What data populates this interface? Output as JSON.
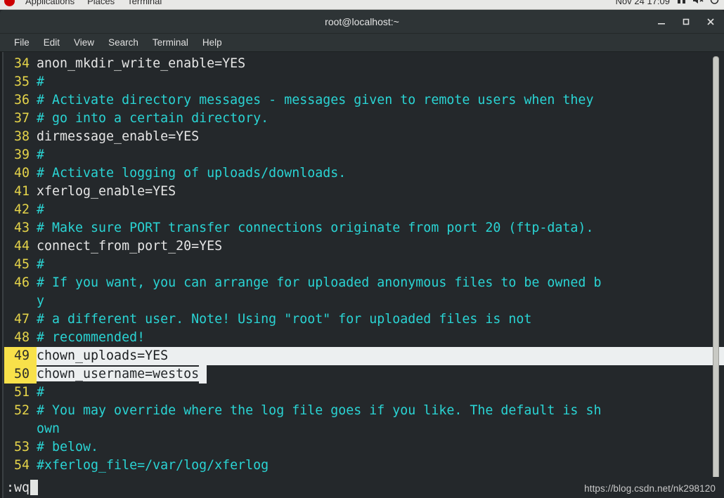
{
  "desktop_panel": {
    "logo_icon": "fedora-logo-icon",
    "menus": [
      "Applications",
      "Places",
      "Terminal"
    ],
    "clock": "Nov 24  17:09",
    "tray_icons": [
      "keyboard-indicator-icon",
      "volume-muted-icon",
      "power-icon"
    ]
  },
  "window": {
    "title": "root@localhost:~",
    "minimize_label": "–",
    "maximize_label": "□",
    "close_label": "✕"
  },
  "menubar": {
    "items": [
      "File",
      "Edit",
      "View",
      "Search",
      "Terminal",
      "Help"
    ]
  },
  "editor": {
    "lines": [
      {
        "num": "34",
        "text": "anon_mkdir_write_enable=YES",
        "comment": false
      },
      {
        "num": "35",
        "text": "#",
        "comment": true
      },
      {
        "num": "36",
        "text": "# Activate directory messages - messages given to remote users when they",
        "comment": true
      },
      {
        "num": "37",
        "text": "# go into a certain directory.",
        "comment": true
      },
      {
        "num": "38",
        "text": "dirmessage_enable=YES",
        "comment": false
      },
      {
        "num": "39",
        "text": "#",
        "comment": true
      },
      {
        "num": "40",
        "text": "# Activate logging of uploads/downloads.",
        "comment": true
      },
      {
        "num": "41",
        "text": "xferlog_enable=YES",
        "comment": false
      },
      {
        "num": "42",
        "text": "#",
        "comment": true
      },
      {
        "num": "43",
        "text": "# Make sure PORT transfer connections originate from port 20 (ftp-data).",
        "comment": true
      },
      {
        "num": "44",
        "text": "connect_from_port_20=YES",
        "comment": false
      },
      {
        "num": "45",
        "text": "#",
        "comment": true
      },
      {
        "num": "46",
        "text": "# If you want, you can arrange for uploaded anonymous files to be owned b",
        "comment": true
      },
      {
        "num": "",
        "text": "y",
        "comment": true
      },
      {
        "num": "47",
        "text": "# a different user. Note! Using \"root\" for uploaded files is not",
        "comment": true
      },
      {
        "num": "48",
        "text": "# recommended!",
        "comment": true
      },
      {
        "num": "49",
        "text": "chown_uploads=YES",
        "comment": false,
        "cursor_line": true
      },
      {
        "num": "50",
        "text": "chown_username=westos",
        "comment": false,
        "selected_run": true
      },
      {
        "num": "51",
        "text": "#",
        "comment": true
      },
      {
        "num": "52",
        "text": "# You may override where the log file goes if you like. The default is sh",
        "comment": true
      },
      {
        "num": "",
        "text": "own",
        "comment": true
      },
      {
        "num": "53",
        "text": "# below.",
        "comment": true
      },
      {
        "num": "54",
        "text": "#xferlog_file=/var/log/xferlog",
        "comment": true
      }
    ],
    "command_line": ":wq",
    "colors": {
      "background": "#24282b",
      "foreground": "#e6e6e6",
      "comment": "#2ad4d4",
      "line_number": "#e5d44a",
      "cursor_line_number_bg": "#f8e14a",
      "cursor_line_bg": "#eceff0"
    }
  },
  "watermark": "https://blog.csdn.net/nk298120"
}
